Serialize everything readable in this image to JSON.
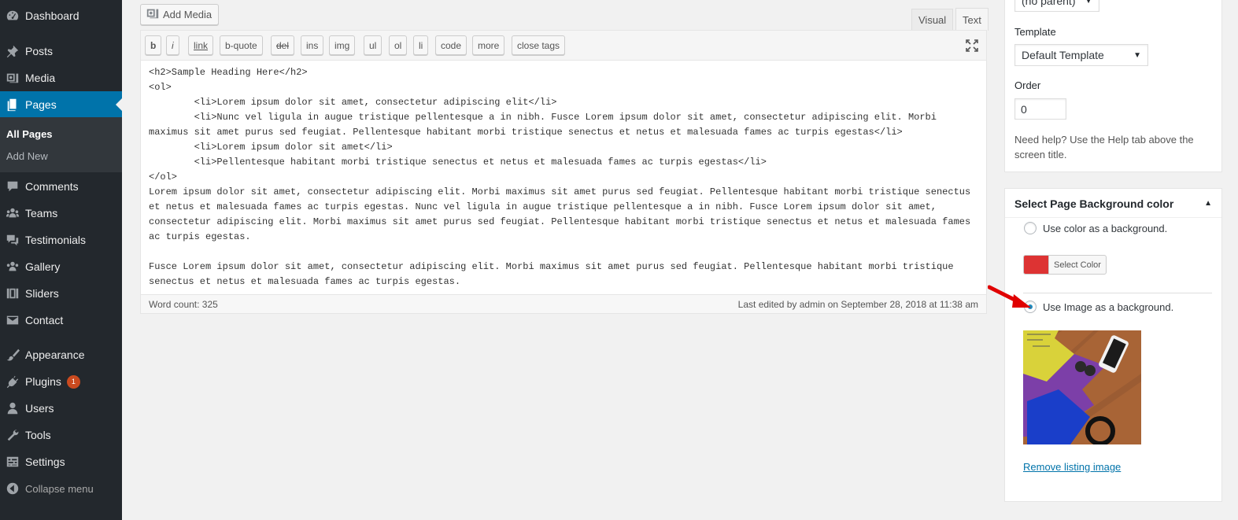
{
  "sidebar": {
    "items": [
      {
        "label": "Dashboard",
        "icon": "dashboard-icon"
      },
      {
        "label": "Posts",
        "icon": "pin-icon"
      },
      {
        "label": "Media",
        "icon": "media-icon"
      },
      {
        "label": "Pages",
        "icon": "pages-icon"
      },
      {
        "label": "Comments",
        "icon": "comment-icon"
      },
      {
        "label": "Teams",
        "icon": "groups-icon"
      },
      {
        "label": "Testimonials",
        "icon": "testimonial-icon"
      },
      {
        "label": "Gallery",
        "icon": "gallery-icon"
      },
      {
        "label": "Sliders",
        "icon": "slides-icon"
      },
      {
        "label": "Contact",
        "icon": "email-icon"
      },
      {
        "label": "Appearance",
        "icon": "brush-icon"
      },
      {
        "label": "Plugins",
        "icon": "plugin-icon",
        "badge": "1"
      },
      {
        "label": "Users",
        "icon": "user-icon"
      },
      {
        "label": "Tools",
        "icon": "wrench-icon"
      },
      {
        "label": "Settings",
        "icon": "settings-icon"
      },
      {
        "label": "Collapse menu",
        "icon": "collapse-icon"
      }
    ],
    "submenu": [
      {
        "label": "All Pages"
      },
      {
        "label": "Add New"
      }
    ],
    "colors": {
      "bg": "#23282d",
      "active": "#0073aa",
      "submenu": "#32373c"
    }
  },
  "editor": {
    "add_media": "Add Media",
    "tabs": [
      {
        "label": "Visual"
      },
      {
        "label": "Text"
      }
    ],
    "toolbar": [
      "b",
      "i",
      "link",
      "b-quote",
      "del",
      "ins",
      "img",
      "ul",
      "ol",
      "li",
      "code",
      "more",
      "close tags"
    ],
    "content": "<h2>Sample Heading Here</h2>\n<ol>\n\t<li>Lorem ipsum dolor sit amet, consectetur adipiscing elit</li>\n\t<li>Nunc vel ligula in augue tristique pellentesque a in nibh. Fusce Lorem ipsum dolor sit amet, consectetur adipiscing elit. Morbi maximus sit amet purus sed feugiat. Pellentesque habitant morbi tristique senectus et netus et malesuada fames ac turpis egestas</li>\n\t<li>Lorem ipsum dolor sit amet</li>\n\t<li>Pellentesque habitant morbi tristique senectus et netus et malesuada fames ac turpis egestas</li>\n</ol>\nLorem ipsum dolor sit amet, consectetur adipiscing elit. Morbi maximus sit amet purus sed feugiat. Pellentesque habitant morbi tristique senectus et netus et malesuada fames ac turpis egestas. Nunc vel ligula in augue tristique pellentesque a in nibh. Fusce Lorem ipsum dolor sit amet, consectetur adipiscing elit. Morbi maximus sit amet purus sed feugiat. Pellentesque habitant morbi tristique senectus et netus et malesuada fames ac turpis egestas.\n\nFusce Lorem ipsum dolor sit amet, consectetur adipiscing elit. Morbi maximus sit amet purus sed feugiat. Pellentesque habitant morbi tristique senectus et netus et malesuada fames ac turpis egestas.",
    "word_count": "Word count: 325",
    "last_edited": "Last edited by admin on September 28, 2018 at 11:38 am"
  },
  "page_attributes": {
    "parent_value": "(no parent)",
    "template_label": "Template",
    "template_value": "Default Template",
    "order_label": "Order",
    "order_value": "0",
    "help_text": "Need help? Use the Help tab above the screen title."
  },
  "bg_panel": {
    "title": "Select Page Background color",
    "option_color": "Use color as a background.",
    "select_color": "Select Color",
    "swatch_color": "#dd3333",
    "option_image": "Use Image as a background.",
    "selected_option": "image",
    "remove_image": "Remove listing image"
  }
}
